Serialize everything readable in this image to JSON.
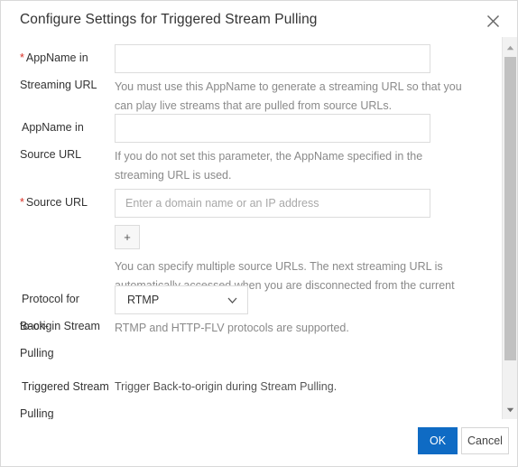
{
  "dialog": {
    "title": "Configure Settings for Triggered Stream Pulling",
    "close_icon": "close-icon"
  },
  "form": {
    "rows": [
      {
        "label_line1": "AppName in",
        "label_line2": "Streaming URL",
        "required": "*",
        "value": "",
        "placeholder": "",
        "helper": "You must use this AppName to generate a streaming URL so that you can play live streams that are pulled from source URLs."
      },
      {
        "label_line1": "AppName in",
        "label_line2": "Source URL",
        "required": "",
        "value": "",
        "placeholder": "",
        "helper": "If you do not set this parameter, the AppName specified in the streaming URL is used."
      },
      {
        "label_line1": "Source URL",
        "label_line2": "",
        "required": "*",
        "value": "",
        "placeholder": "Enter a domain name or an IP address",
        "add_label": "+",
        "helper": "You can specify multiple source URLs. The next streaming URL is automatically accessed when you are disconnected from the current live stream."
      },
      {
        "label_line1": "Protocol for Back-",
        "label_line2": "to-origin Stream",
        "label_line3": "Pulling",
        "required": "",
        "selected": "RTMP",
        "helper": "RTMP and HTTP-FLV protocols are supported."
      },
      {
        "label_line1": "Triggered Stream",
        "label_line2": "Pulling",
        "required": "",
        "text": "Trigger Back-to-origin during Stream Pulling."
      }
    ]
  },
  "scrollbar": {
    "up_icon": "caret-up-icon",
    "down_icon": "caret-down-icon"
  },
  "footer": {
    "ok_label": "OK",
    "cancel_label": "Cancel"
  },
  "colors": {
    "primary": "#0f6bc4",
    "required": "#d93026",
    "helper_text": "#8a8a8a",
    "label_text": "#333333",
    "border": "#dcdcdc"
  }
}
